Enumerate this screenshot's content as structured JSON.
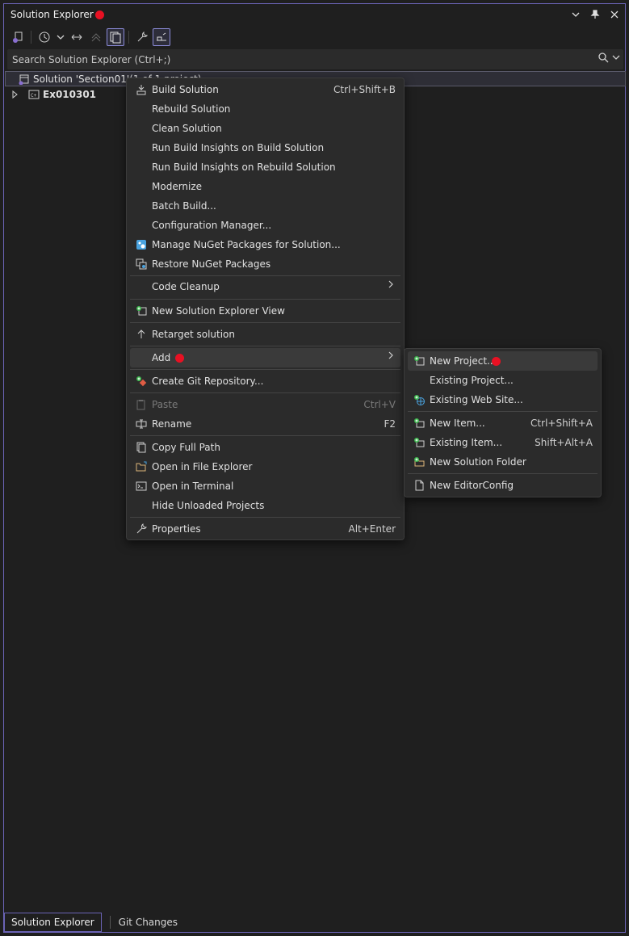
{
  "window": {
    "title": "Solution Explorer"
  },
  "search": {
    "placeholder": "Search Solution Explorer (Ctrl+;)"
  },
  "tree": {
    "solution_label": "Solution 'Section01'",
    "solution_suffix": " (1 of 1 project)",
    "project_label": "Ex010301"
  },
  "context_menu": {
    "items": [
      {
        "label": "Build Solution",
        "shortcut": "Ctrl+Shift+B"
      },
      {
        "label": "Rebuild Solution"
      },
      {
        "label": "Clean Solution"
      },
      {
        "label": "Run Build Insights on Build Solution"
      },
      {
        "label": "Run Build Insights on Rebuild Solution"
      },
      {
        "label": "Modernize"
      },
      {
        "label": "Batch Build..."
      },
      {
        "label": "Configuration Manager..."
      },
      {
        "label": "Manage NuGet Packages for Solution..."
      },
      {
        "label": "Restore NuGet Packages"
      },
      {
        "label": "Code Cleanup"
      },
      {
        "label": "New Solution Explorer View"
      },
      {
        "label": "Retarget solution"
      },
      {
        "label": "Add"
      },
      {
        "label": "Create Git Repository..."
      },
      {
        "label": "Paste",
        "shortcut": "Ctrl+V"
      },
      {
        "label": "Rename",
        "shortcut": "F2"
      },
      {
        "label": "Copy Full Path"
      },
      {
        "label": "Open in File Explorer"
      },
      {
        "label": "Open in Terminal"
      },
      {
        "label": "Hide Unloaded Projects"
      },
      {
        "label": "Properties",
        "shortcut": "Alt+Enter"
      }
    ]
  },
  "add_submenu": {
    "items": [
      {
        "label": "New Project..."
      },
      {
        "label": "Existing Project..."
      },
      {
        "label": "Existing Web Site..."
      },
      {
        "label": "New Item...",
        "shortcut": "Ctrl+Shift+A"
      },
      {
        "label": "Existing Item...",
        "shortcut": "Shift+Alt+A"
      },
      {
        "label": "New Solution Folder"
      },
      {
        "label": "New EditorConfig"
      }
    ]
  },
  "bottom_tabs": [
    {
      "label": "Solution Explorer"
    },
    {
      "label": "Git Changes"
    }
  ],
  "colors": {
    "accent": "#6b63b5",
    "marker_red": "#e81123",
    "background": "#1f1f1f",
    "menu_bg": "#2b2b2b"
  }
}
